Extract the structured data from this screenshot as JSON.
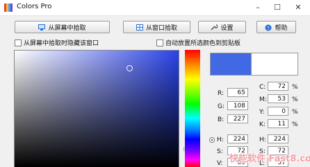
{
  "window": {
    "title": "Colors Pro",
    "minimize": "–",
    "maximize": "☐",
    "close": "✕"
  },
  "toolbar": {
    "pick_screen": "从屏幕中拾取",
    "pick_window": "从窗口拾取",
    "settings": "设置",
    "help": "帮助"
  },
  "options": {
    "hide_window_label": "从屏幕中拾取时隐藏该窗口",
    "auto_copy_label": "自动放置所选颜色到剪贴板"
  },
  "colors": {
    "current": "#4169e3",
    "previous": "#ffffff"
  },
  "rgb": {
    "r_label": "R:",
    "r": "65",
    "g_label": "G:",
    "g": "108",
    "b_label": "B:",
    "b": "227"
  },
  "cmyk": {
    "c_label": "C:",
    "c": "72",
    "m_label": "M:",
    "m": "53",
    "y_label": "Y:",
    "y": "0",
    "k_label": "K:",
    "k": "11",
    "unit": "%"
  },
  "hsv": {
    "h_label": "H:",
    "h": "224",
    "s_label": "S:",
    "s": "72",
    "v_label": "V:",
    "v": "89"
  },
  "hsl": {
    "h_label": "H:",
    "h": "224",
    "s_label": "S:",
    "s": "72",
    "l_label": "L:",
    "l": "57"
  },
  "watermark": "快些软件 Fast8.com"
}
